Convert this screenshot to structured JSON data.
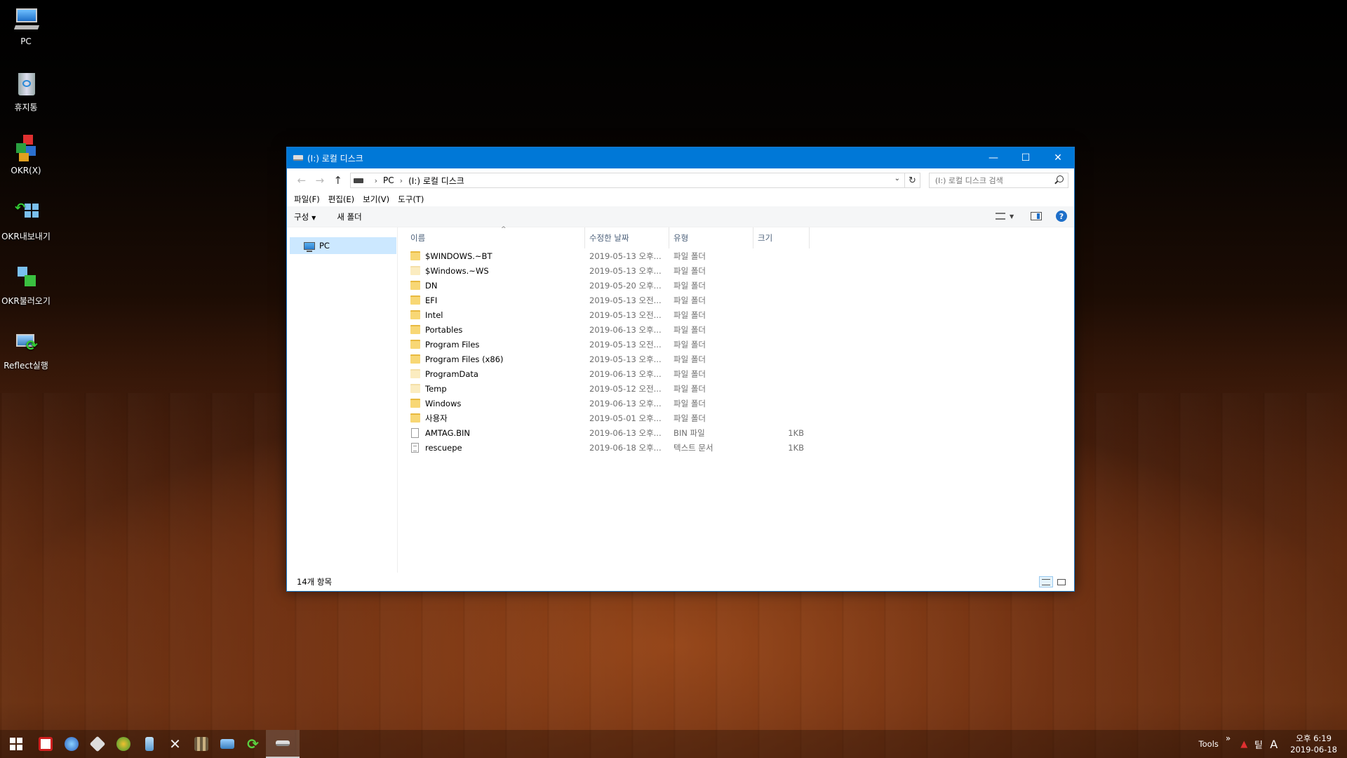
{
  "desktop": {
    "icons": [
      {
        "label": "PC",
        "icon": "pc-icon"
      },
      {
        "label": "휴지통",
        "icon": "recycle-bin-icon"
      },
      {
        "label": "OKR(X)",
        "icon": "okr-icon"
      },
      {
        "label": "OKR내보내기",
        "icon": "okr-export-icon"
      },
      {
        "label": "OKR불러오기",
        "icon": "okr-import-icon"
      },
      {
        "label": "Reflect실행",
        "icon": "reflect-icon"
      }
    ]
  },
  "window": {
    "title": "(I:) 로컬 디스크",
    "controls": {
      "minimize": "—",
      "maximize": "☐",
      "close": "✕"
    },
    "address": {
      "root": "PC",
      "current": "(I:) 로컬 디스크"
    },
    "search": {
      "placeholder": "(I:) 로컬 디스크 검색"
    },
    "menu": [
      "파일(F)",
      "편집(E)",
      "보기(V)",
      "도구(T)"
    ],
    "commands": {
      "organize": "구성",
      "new_folder": "새 폴더"
    },
    "nav": {
      "selected": "PC"
    },
    "columns": {
      "name": "이름",
      "date": "수정한 날짜",
      "type": "유형",
      "size": "크기"
    },
    "files": [
      {
        "name": "$WINDOWS.~BT",
        "date": "2019-05-13 오후...",
        "type": "파일 폴더",
        "size": "",
        "kind": "folder"
      },
      {
        "name": "$Windows.~WS",
        "date": "2019-05-13 오후...",
        "type": "파일 폴더",
        "size": "",
        "kind": "folder-hidden"
      },
      {
        "name": "DN",
        "date": "2019-05-20 오후...",
        "type": "파일 폴더",
        "size": "",
        "kind": "folder"
      },
      {
        "name": "EFI",
        "date": "2019-05-13 오전...",
        "type": "파일 폴더",
        "size": "",
        "kind": "folder"
      },
      {
        "name": "Intel",
        "date": "2019-05-13 오전...",
        "type": "파일 폴더",
        "size": "",
        "kind": "folder"
      },
      {
        "name": "Portables",
        "date": "2019-06-13 오후...",
        "type": "파일 폴더",
        "size": "",
        "kind": "folder"
      },
      {
        "name": "Program Files",
        "date": "2019-05-13 오전...",
        "type": "파일 폴더",
        "size": "",
        "kind": "folder"
      },
      {
        "name": "Program Files (x86)",
        "date": "2019-05-13 오후...",
        "type": "파일 폴더",
        "size": "",
        "kind": "folder"
      },
      {
        "name": "ProgramData",
        "date": "2019-06-13 오후...",
        "type": "파일 폴더",
        "size": "",
        "kind": "folder-hidden"
      },
      {
        "name": "Temp",
        "date": "2019-05-12 오전...",
        "type": "파일 폴더",
        "size": "",
        "kind": "folder-hidden"
      },
      {
        "name": "Windows",
        "date": "2019-06-13 오후...",
        "type": "파일 폴더",
        "size": "",
        "kind": "folder"
      },
      {
        "name": "사용자",
        "date": "2019-05-01 오후...",
        "type": "파일 폴더",
        "size": "",
        "kind": "folder"
      },
      {
        "name": "AMTAG.BIN",
        "date": "2019-06-13 오후...",
        "type": "BIN 파일",
        "size": "1KB",
        "kind": "file"
      },
      {
        "name": "rescuepe",
        "date": "2019-06-18 오후...",
        "type": "텍스트 문서",
        "size": "1KB",
        "kind": "text"
      }
    ],
    "status": "14개 항목"
  },
  "taskbar": {
    "tray_tools": "Tools",
    "tray_chevron": "»",
    "ime_lang": "A",
    "ime_mode": "팉",
    "clock_time": "오후 6:19",
    "clock_date": "2019-06-18"
  },
  "colors": {
    "titlebar": "#0078d7",
    "selection": "#cce8ff",
    "folder": "#f8d775"
  }
}
